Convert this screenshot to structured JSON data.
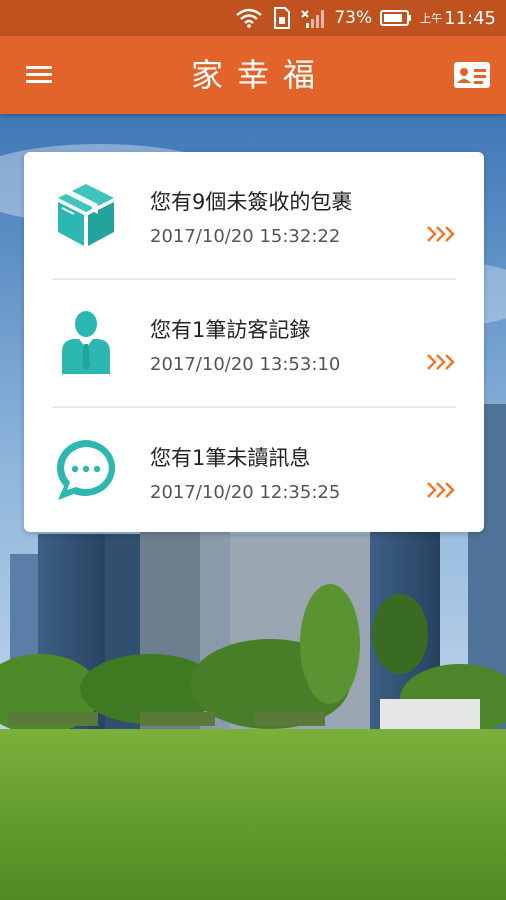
{
  "status_bar": {
    "battery": "73%",
    "time_prefix": "上午",
    "time": "11:45",
    "icons": [
      "wifi-icon",
      "sim-icon",
      "signal-icon",
      "battery-icon"
    ]
  },
  "app_bar": {
    "title": "家幸福",
    "left_icon": "menu-icon",
    "right_icon": "id-card-icon",
    "color": "#e3642a"
  },
  "notifications": [
    {
      "icon": "package-box-icon",
      "title": "您有9個未簽收的包裹",
      "time": "2017/10/20 15:32:22"
    },
    {
      "icon": "visitor-person-icon",
      "title": "您有1筆訪客記錄",
      "time": "2017/10/20 13:53:10"
    },
    {
      "icon": "chat-bubble-icon",
      "title": "您有1筆未讀訊息",
      "time": "2017/10/20 12:35:25"
    }
  ],
  "colors": {
    "accent": "#e3642a",
    "status_bar": "#c0521f",
    "icon_teal": "#2cb8b0",
    "arrow": "#f07a2a"
  }
}
